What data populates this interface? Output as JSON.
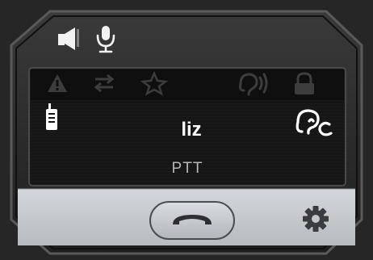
{
  "contact": {
    "name": "liz",
    "mode": "PTT"
  },
  "top_icons": [
    "speaker-icon",
    "microphone-icon"
  ],
  "status_icons": [
    "warning-icon",
    "transfer-icon",
    "star-icon",
    "hearing-icon",
    "lock-icon"
  ],
  "side_icons": {
    "left": "radio-icon",
    "right": "hearing-aid-icon"
  },
  "bottom_bar": {
    "center": "end-call-button",
    "right": "settings-gear-icon"
  },
  "colors": {
    "bezel": "#2b2b2b",
    "screen": "#161616",
    "status_strip": "#0f0f0f",
    "status_icon": "#3d3d3d",
    "text": "#ffffff",
    "subtext": "#b5b5b5",
    "bottom_bar": "#c7cbd0"
  }
}
